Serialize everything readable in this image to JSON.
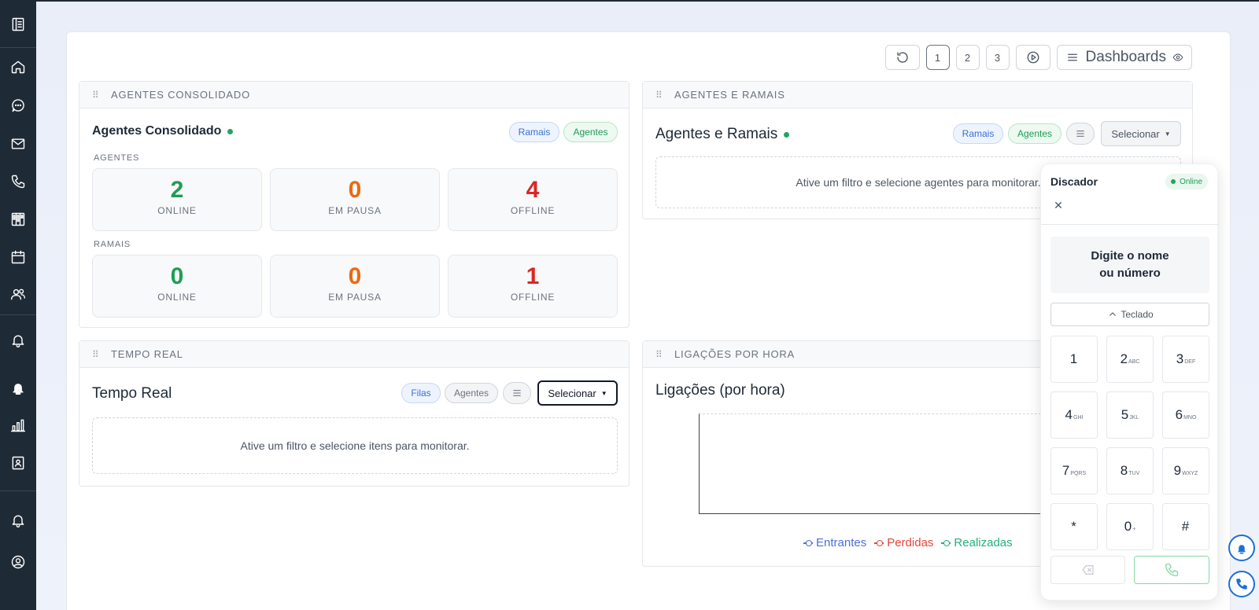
{
  "sidebar": {
    "items": [
      {
        "icon": "book-icon",
        "name": "sidebar-item-menu"
      },
      {
        "icon": "home-icon",
        "name": "sidebar-item-home"
      },
      {
        "icon": "chat-icon",
        "name": "sidebar-item-chat"
      },
      {
        "icon": "mail-icon",
        "name": "sidebar-item-mail"
      },
      {
        "icon": "phone-icon",
        "name": "sidebar-item-calls"
      },
      {
        "icon": "kanban-icon",
        "name": "sidebar-item-board"
      },
      {
        "icon": "calendar-icon",
        "name": "sidebar-item-calendar"
      },
      {
        "icon": "users-icon",
        "name": "sidebar-item-users"
      },
      {
        "icon": "bell-icon",
        "name": "sidebar-item-alerts"
      },
      {
        "icon": "bell-solid-icon",
        "name": "sidebar-item-notifications"
      },
      {
        "icon": "bar-chart-icon",
        "name": "sidebar-item-reports"
      },
      {
        "icon": "contact-card-icon",
        "name": "sidebar-item-contacts"
      },
      {
        "icon": "bell-icon",
        "name": "sidebar-item-bottom-bell"
      },
      {
        "icon": "user-circle-icon",
        "name": "sidebar-item-profile"
      }
    ]
  },
  "toolbar": {
    "pages": [
      "1",
      "2",
      "3"
    ],
    "active_page": "1",
    "dashboards_label": "Dashboards"
  },
  "agentes_consolidado": {
    "header": "AGENTES CONSOLIDADO",
    "title": "Agentes Consolidado",
    "pill_ramais": "Ramais",
    "pill_agentes": "Agentes",
    "section_agentes": "AGENTES",
    "section_ramais": "RAMAIS",
    "agentes": {
      "online": "2",
      "online_label": "ONLINE",
      "pausa": "0",
      "pausa_label": "EM PAUSA",
      "offline": "4",
      "offline_label": "OFFLINE"
    },
    "ramais": {
      "online": "0",
      "online_label": "ONLINE",
      "pausa": "0",
      "pausa_label": "EM PAUSA",
      "offline": "1",
      "offline_label": "OFFLINE"
    }
  },
  "agentes_ramais": {
    "header": "AGENTES E RAMAIS",
    "title": "Agentes e Ramais",
    "pill_ramais": "Ramais",
    "pill_agentes": "Agentes",
    "select_label": "Selecionar",
    "empty_text": "Ative um filtro e selecione agentes para monitorar."
  },
  "tempo_real": {
    "header": "TEMPO REAL",
    "title": "Tempo Real",
    "pill_filas": "Filas",
    "pill_agentes": "Agentes",
    "select_label": "Selecionar",
    "empty_text": "Ative um filtro e selecione itens para monitorar."
  },
  "ligacoes": {
    "header": "LIGAÇÕES POR HORA",
    "title": "Ligações (por hora)",
    "legend": [
      {
        "label": "Entrantes",
        "color": "#4a6fd8"
      },
      {
        "label": "Perdidas",
        "color": "#e0473a"
      },
      {
        "label": "Realizadas",
        "color": "#22b07a"
      }
    ]
  },
  "dialer": {
    "title": "Discador",
    "status": "Online",
    "input_line1": "Digite o nome",
    "input_line2": "ou número",
    "keyboard_toggle": "Teclado",
    "keys": [
      {
        "d": "1",
        "s": ""
      },
      {
        "d": "2",
        "s": "ABC"
      },
      {
        "d": "3",
        "s": "DEF"
      },
      {
        "d": "4",
        "s": "GHI"
      },
      {
        "d": "5",
        "s": "JKL"
      },
      {
        "d": "6",
        "s": "MNO"
      },
      {
        "d": "7",
        "s": "PQRS"
      },
      {
        "d": "8",
        "s": "TUV"
      },
      {
        "d": "9",
        "s": "WXYZ"
      },
      {
        "d": "*",
        "s": ""
      },
      {
        "d": "0",
        "s": "+"
      },
      {
        "d": "#",
        "s": ""
      }
    ]
  },
  "colors": {
    "sidebar": "#1f2a37",
    "online": "#1f9d55",
    "pause": "#ea6a12",
    "offline": "#dc2626",
    "accent": "#1d6fd6"
  }
}
